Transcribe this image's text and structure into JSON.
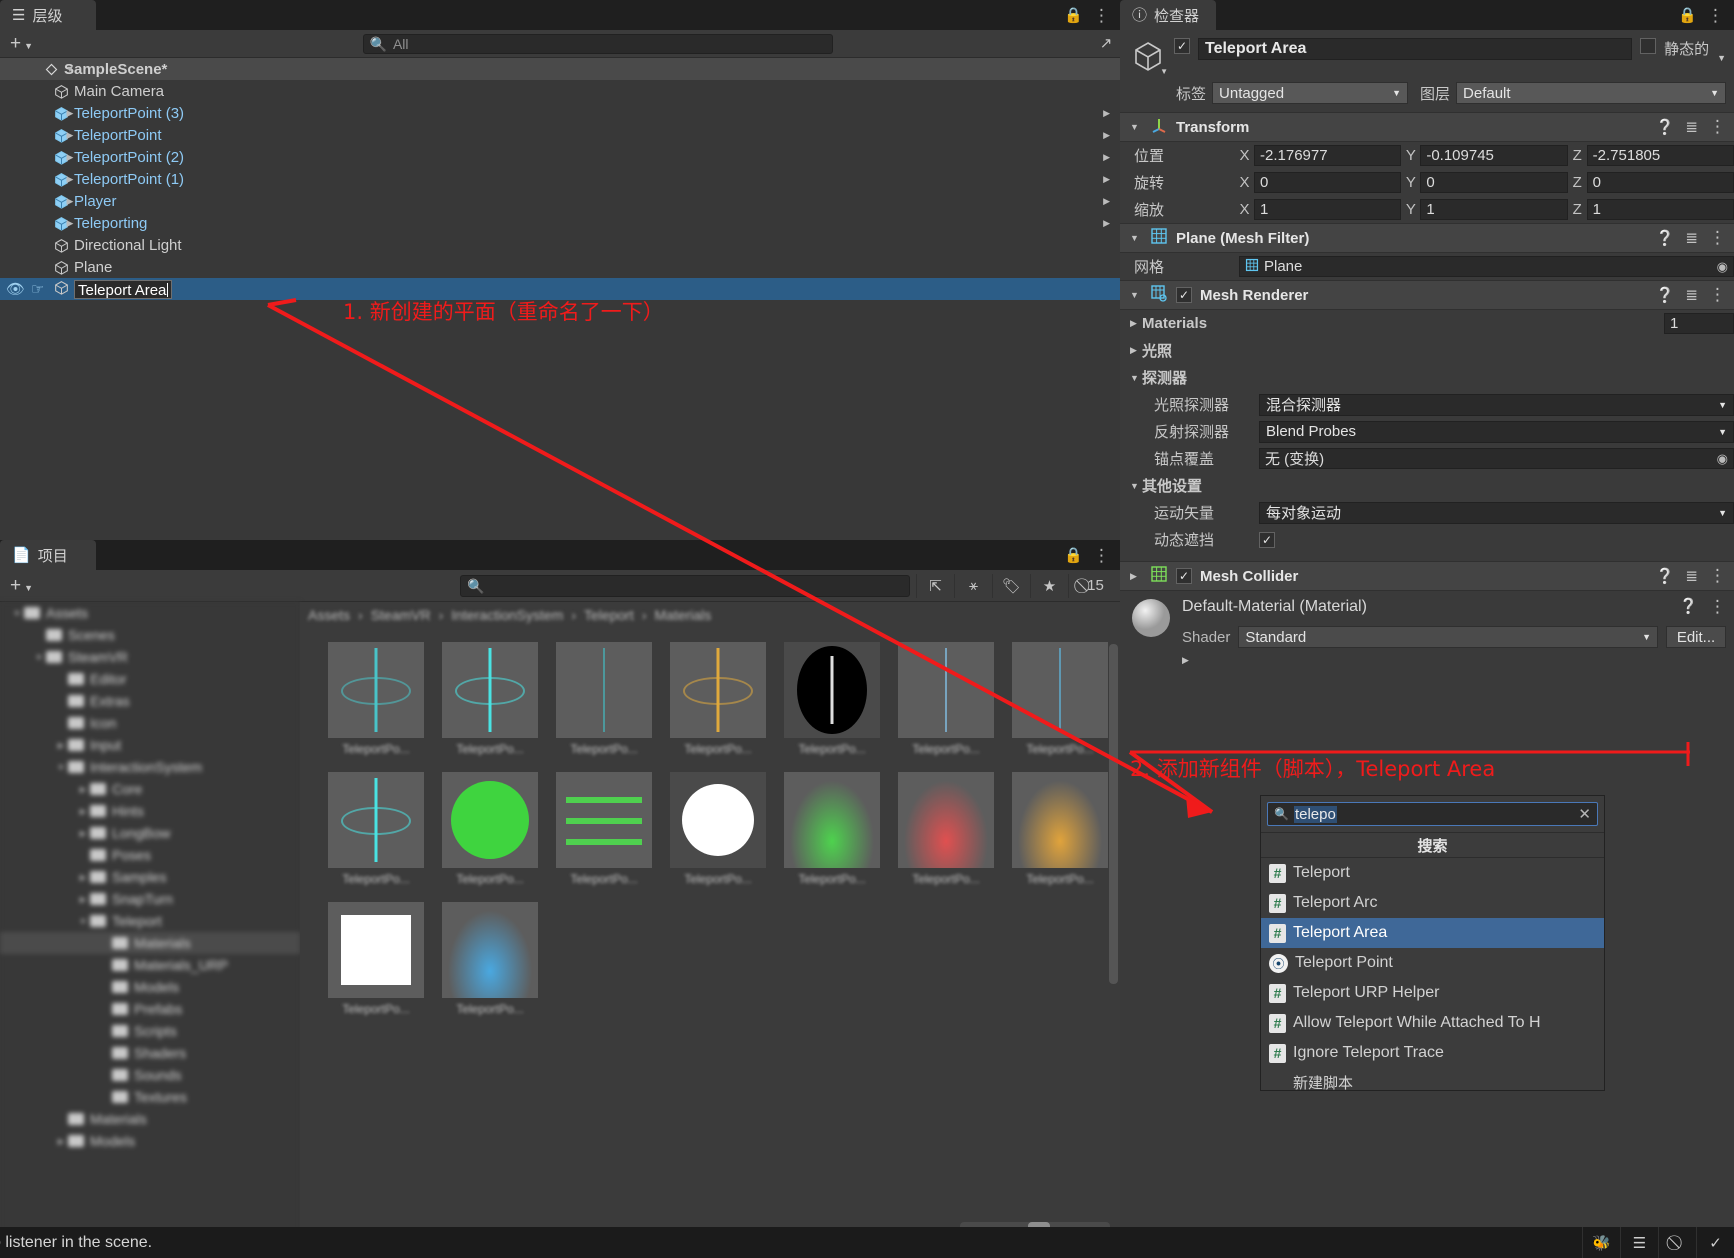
{
  "hierarchy": {
    "tab_label": "层级",
    "tab_icon": "list-icon",
    "add_label": "+",
    "search_placeholder": "All",
    "search_value": "",
    "lock_icon": "lock-icon",
    "menu_icon": "kebab-icon",
    "rows": [
      {
        "label": "SampleScene*",
        "type": "scene",
        "indent": 0,
        "twisty": "▼"
      },
      {
        "label": "Main Camera",
        "type": "plain",
        "indent": 1,
        "twisty": ""
      },
      {
        "label": "TeleportPoint (3)",
        "type": "prefab",
        "indent": 1,
        "twisty": "▶"
      },
      {
        "label": "TeleportPoint",
        "type": "prefab",
        "indent": 1,
        "twisty": "▶"
      },
      {
        "label": "TeleportPoint (2)",
        "type": "prefab",
        "indent": 1,
        "twisty": "▶"
      },
      {
        "label": "TeleportPoint (1)",
        "type": "prefab",
        "indent": 1,
        "twisty": "▶"
      },
      {
        "label": "Player",
        "type": "prefab",
        "indent": 1,
        "twisty": "▶"
      },
      {
        "label": "Teleporting",
        "type": "prefab",
        "indent": 1,
        "twisty": "▶"
      },
      {
        "label": "Directional Light",
        "type": "plain",
        "indent": 1,
        "twisty": ""
      },
      {
        "label": "Plane",
        "type": "plain",
        "indent": 1,
        "twisty": ""
      },
      {
        "label": "Teleport Area",
        "type": "renaming",
        "indent": 1,
        "twisty": ""
      }
    ]
  },
  "project": {
    "tab_label": "项目",
    "tab_icon": "file-icon",
    "add_label": "+",
    "search_placeholder": "",
    "search_value": "",
    "hidden_count": "15",
    "toolbar_icons": [
      "save-filter-icon",
      "packages-icon",
      "label-icon",
      "favorite-star-icon",
      "hidden-eye-icon"
    ],
    "breadcrumb": [
      "Assets",
      "SteamVR",
      "InteractionSystem",
      "Teleport",
      "Materials"
    ],
    "tree": [
      {
        "label": "Assets",
        "indent": 0,
        "twisty": "▼",
        "selected": false
      },
      {
        "label": "Scenes",
        "indent": 1,
        "twisty": "",
        "selected": false
      },
      {
        "label": "SteamVR",
        "indent": 1,
        "twisty": "▼",
        "selected": false
      },
      {
        "label": "Editor",
        "indent": 2,
        "twisty": "",
        "selected": false
      },
      {
        "label": "Extras",
        "indent": 2,
        "twisty": "",
        "selected": false
      },
      {
        "label": "Icon",
        "indent": 2,
        "twisty": "",
        "selected": false
      },
      {
        "label": "Input",
        "indent": 2,
        "twisty": "▶",
        "selected": false
      },
      {
        "label": "InteractionSystem",
        "indent": 2,
        "twisty": "▼",
        "selected": false
      },
      {
        "label": "Core",
        "indent": 3,
        "twisty": "▶",
        "selected": false
      },
      {
        "label": "Hints",
        "indent": 3,
        "twisty": "▶",
        "selected": false
      },
      {
        "label": "LongBow",
        "indent": 3,
        "twisty": "▶",
        "selected": false
      },
      {
        "label": "Poses",
        "indent": 3,
        "twisty": "",
        "selected": false
      },
      {
        "label": "Samples",
        "indent": 3,
        "twisty": "▶",
        "selected": false
      },
      {
        "label": "SnapTurn",
        "indent": 3,
        "twisty": "▶",
        "selected": false
      },
      {
        "label": "Teleport",
        "indent": 3,
        "twisty": "▼",
        "selected": false
      },
      {
        "label": "Materials",
        "indent": 4,
        "twisty": "",
        "selected": true
      },
      {
        "label": "Materials_URP",
        "indent": 4,
        "twisty": "",
        "selected": false
      },
      {
        "label": "Models",
        "indent": 4,
        "twisty": "",
        "selected": false
      },
      {
        "label": "Prefabs",
        "indent": 4,
        "twisty": "",
        "selected": false
      },
      {
        "label": "Scripts",
        "indent": 4,
        "twisty": "",
        "selected": false
      },
      {
        "label": "Shaders",
        "indent": 4,
        "twisty": "",
        "selected": false
      },
      {
        "label": "Sounds",
        "indent": 4,
        "twisty": "",
        "selected": false
      },
      {
        "label": "Textures",
        "indent": 4,
        "twisty": "",
        "selected": false
      },
      {
        "label": "Materials",
        "indent": 2,
        "twisty": "",
        "selected": false
      },
      {
        "label": "Models",
        "indent": 2,
        "twisty": "▶",
        "selected": false
      }
    ],
    "assets": [
      {
        "label": "TeleportPo...",
        "kind": "marker",
        "color": "#49c4c9",
        "bg": "#5d5d5d"
      },
      {
        "label": "TeleportPo...",
        "kind": "marker",
        "color": "#49e3e3",
        "bg": "#5d5d5d"
      },
      {
        "label": "TeleportPo...",
        "kind": "line",
        "color": "#4aa8ad",
        "bg": "#5d5d5d"
      },
      {
        "label": "TeleportPo...",
        "kind": "marker",
        "color": "#e0a93c",
        "bg": "#5d5d5d"
      },
      {
        "label": "TeleportPo...",
        "kind": "black",
        "color": "#000000",
        "bg": "#4a4a4a"
      },
      {
        "label": "TeleportPo...",
        "kind": "line",
        "color": "#7fb7d8",
        "bg": "#5d5d5d"
      },
      {
        "label": "TeleportPo...",
        "kind": "line",
        "color": "#5fa8c8",
        "bg": "#5d5d5d"
      },
      {
        "label": "TeleportPo...",
        "kind": "marker",
        "color": "#49e3e3",
        "bg": "#5d5d5d"
      },
      {
        "label": "TeleportPo...",
        "kind": "circle",
        "color": "#3fd43f",
        "bg": "#5d5d5d"
      },
      {
        "label": "TeleportPo...",
        "kind": "stripes",
        "color": "#4fd04f",
        "bg": "#5d5d5d"
      },
      {
        "label": "TeleportPo...",
        "kind": "white-circle",
        "color": "#ffffff",
        "bg": "#4a4a4a"
      },
      {
        "label": "TeleportPo...",
        "kind": "gradient",
        "color": "#4ed24e",
        "bg": "#5d5d5d"
      },
      {
        "label": "TeleportPo...",
        "kind": "gradient",
        "color": "#e05050",
        "bg": "#5d5d5d"
      },
      {
        "label": "TeleportPo...",
        "kind": "gradient",
        "color": "#e0a33c",
        "bg": "#5d5d5d"
      },
      {
        "label": "TeleportPo...",
        "kind": "white-square",
        "color": "#ffffff",
        "bg": "#5d5d5d"
      },
      {
        "label": "TeleportPo...",
        "kind": "gradient",
        "color": "#4aa8e0",
        "bg": "#5d5d5d"
      }
    ]
  },
  "inspector": {
    "tab_label": "检查器",
    "tab_icon": "info-icon",
    "lock_icon": "lock-icon",
    "menu_icon": "kebab-icon",
    "object_icon": "gameobject-cube-icon",
    "enabled": true,
    "name": "Teleport Area",
    "static_label": "静态的",
    "static_checked": false,
    "tag_label": "标签",
    "tag_value": "Untagged",
    "layer_label": "图层",
    "layer_value": "Default",
    "transform": {
      "title": "Transform",
      "icon": "transform-axis-icon",
      "rows": [
        {
          "label": "位置",
          "x": "-2.176977",
          "y": "-0.109745",
          "z": "-2.751805"
        },
        {
          "label": "旋转",
          "x": "0",
          "y": "0",
          "z": "0"
        },
        {
          "label": "缩放",
          "x": "1",
          "y": "1",
          "z": "1"
        }
      ]
    },
    "mesh_filter": {
      "title": "Plane (Mesh Filter)",
      "icon": "mesh-filter-grid-icon",
      "mesh_label": "网格",
      "mesh_value": "Plane"
    },
    "mesh_renderer": {
      "title": "Mesh Renderer",
      "icon": "mesh-renderer-icon",
      "enabled": true,
      "materials_label": "Materials",
      "materials_count": "1",
      "lighting_label": "光照",
      "probes_label": "探测器",
      "light_probes_label": "光照探测器",
      "light_probes_value": "混合探测器",
      "reflection_probes_label": "反射探测器",
      "reflection_probes_value": "Blend Probes",
      "anchor_override_label": "锚点覆盖",
      "anchor_override_value": "无 (变换)",
      "other_settings_label": "其他设置",
      "motion_vectors_label": "运动矢量",
      "motion_vectors_value": "每对象运动",
      "dynamic_occlusion_label": "动态遮挡",
      "dynamic_occlusion_checked": true
    },
    "mesh_collider": {
      "title": "Mesh Collider",
      "icon": "mesh-collider-icon",
      "enabled": true
    },
    "material": {
      "title": "Default-Material (Material)",
      "preview_icon": "material-sphere-icon",
      "shader_label": "Shader",
      "shader_value": "Standard",
      "edit_label": "Edit..."
    }
  },
  "add_component_popup": {
    "search_icon": "search-icon",
    "search_value": "telepo",
    "clear_icon": "close-icon",
    "title": "搜索",
    "items": [
      {
        "label": "Teleport",
        "icon": "csharp-script-icon",
        "selected": false
      },
      {
        "label": "Teleport Arc",
        "icon": "csharp-script-icon",
        "selected": false
      },
      {
        "label": "Teleport Area",
        "icon": "csharp-script-icon",
        "selected": true
      },
      {
        "label": "Teleport Point",
        "icon": "steamvr-icon",
        "selected": false
      },
      {
        "label": "Teleport URP Helper",
        "icon": "csharp-script-icon",
        "selected": false
      },
      {
        "label": "Allow Teleport While Attached To H",
        "icon": "csharp-script-icon",
        "selected": false
      },
      {
        "label": "Ignore Teleport Trace",
        "icon": "csharp-script-icon",
        "selected": false
      }
    ],
    "new_script_label": "新建脚本"
  },
  "annotations": {
    "color": "#f01b1b",
    "note1": "1. 新创建的平面（重命名了一下）",
    "note2": "2. 添加新组件（脚本），Teleport Area"
  },
  "statusbar": {
    "message": "o listener in the scene.",
    "icons": [
      "bug-icon",
      "layers-icon",
      "collab-icon",
      "check-icon"
    ]
  }
}
